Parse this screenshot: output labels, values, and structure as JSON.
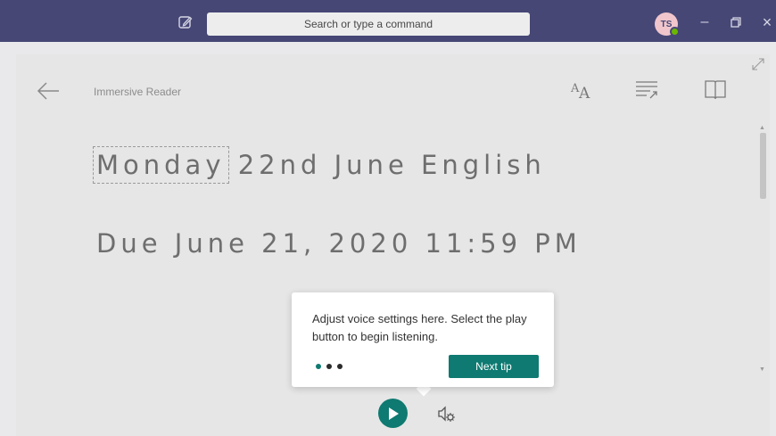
{
  "titlebar": {
    "search_placeholder": "Search or type a command",
    "avatar_initials": "TS",
    "minimize": "–",
    "restore": "❐",
    "close": "×",
    "icons": [
      "compose-icon",
      "presence-icon"
    ]
  },
  "reader": {
    "title": "Immersive Reader",
    "toolbar_icons": [
      "text-preferences-icon",
      "grammar-options-icon",
      "reading-preferences-icon",
      "expand-icon",
      "back-arrow-icon"
    ],
    "line1_focus": "Monday",
    "line1_rest": " 22nd June English",
    "line2": "Due June 21, 2020 11:59 PM"
  },
  "tip": {
    "text": "Adjust voice settings here. Select the play button to begin listening.",
    "next_label": "Next tip",
    "dots": 3,
    "active_dot": 1
  },
  "controls": {
    "icons": [
      "play-icon",
      "voice-settings-icon"
    ]
  },
  "colors": {
    "titlebar": "#464775",
    "accent": "#0e7a71",
    "panel": "#e6e6e6"
  }
}
